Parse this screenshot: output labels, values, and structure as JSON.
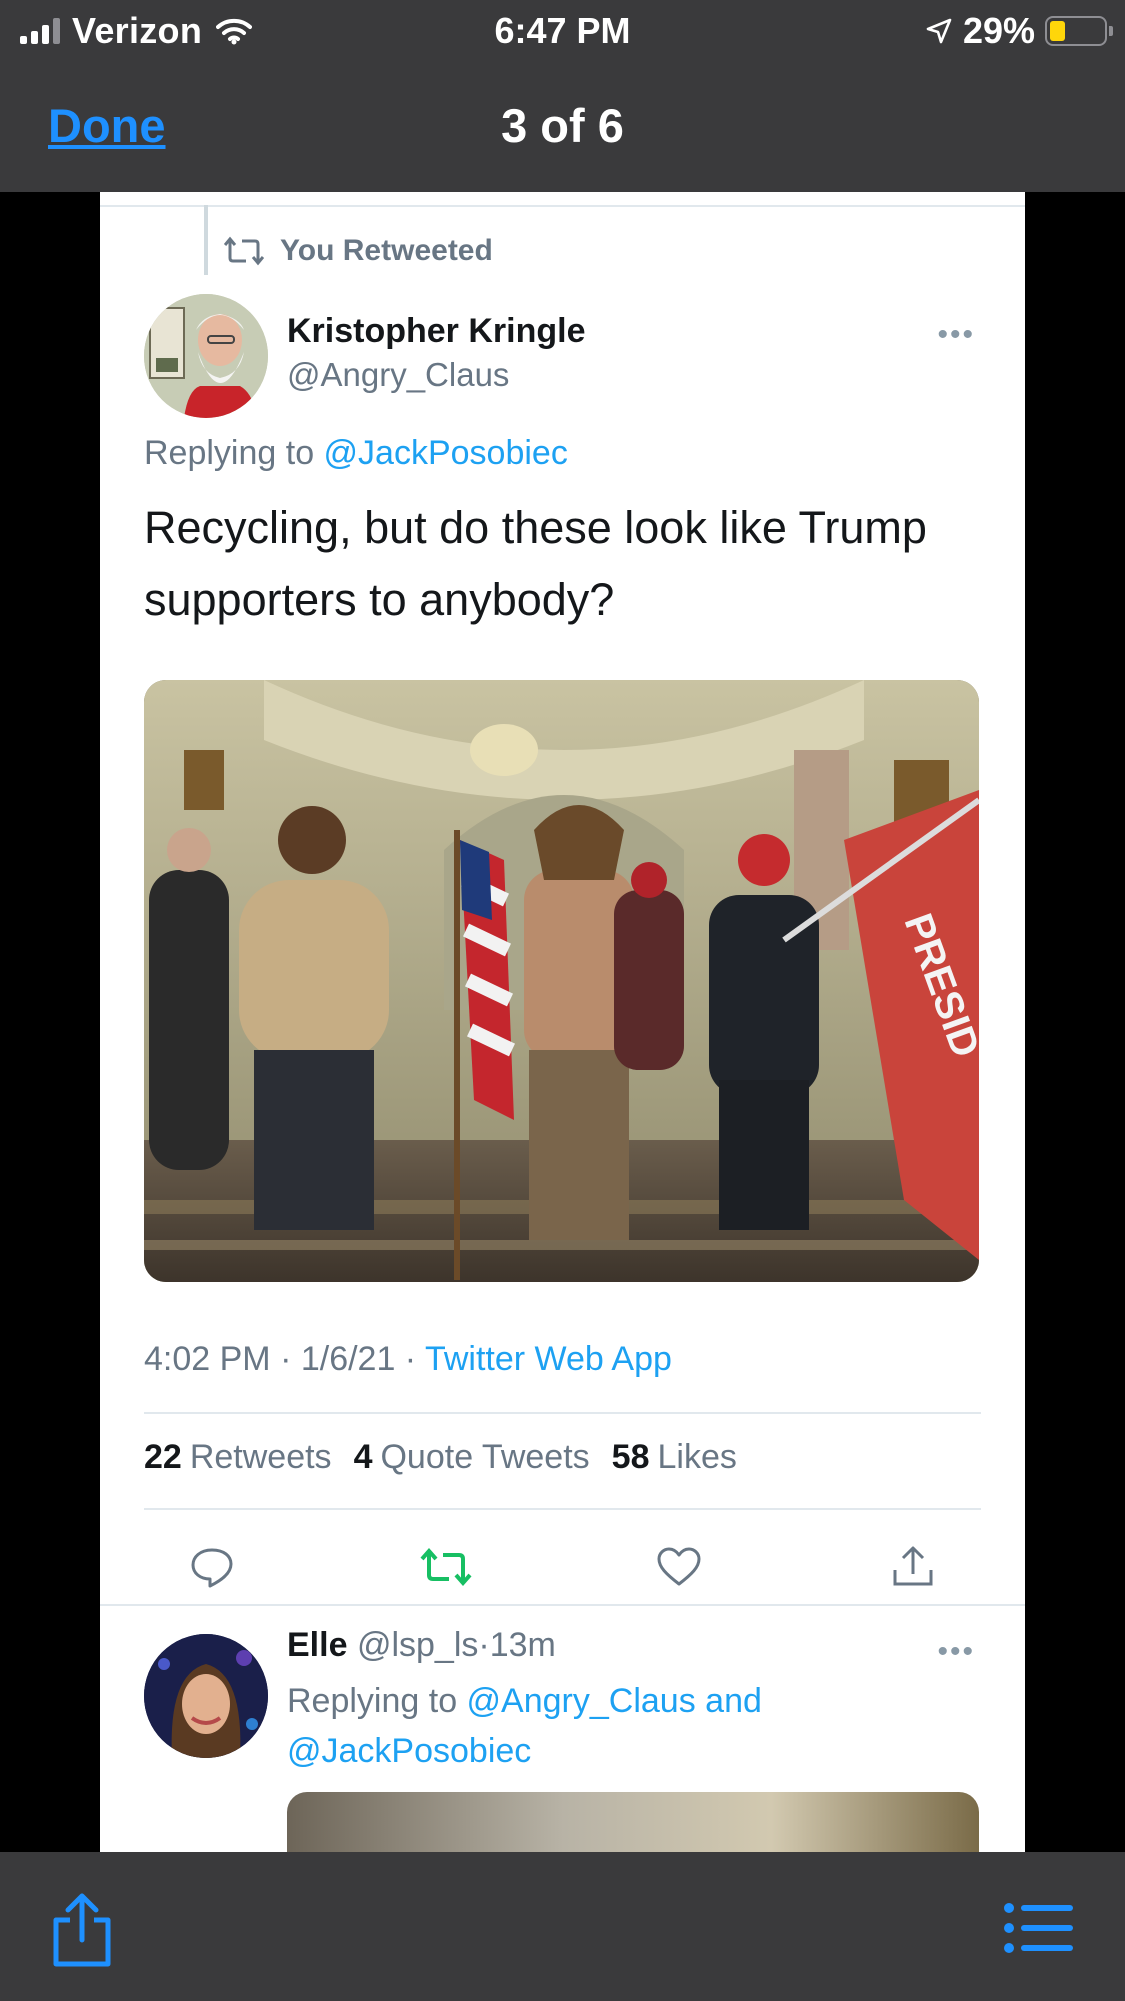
{
  "status_bar": {
    "carrier": "Verizon",
    "time": "6:47 PM",
    "battery_percent": "29%",
    "battery_level": 0.29,
    "icons": [
      "signal-icon",
      "wifi-icon",
      "location-arrow-icon",
      "battery-icon"
    ]
  },
  "nav": {
    "done_label": "Done",
    "title": "3 of 6"
  },
  "tweet": {
    "retweet_context": "You Retweeted",
    "author_name": "Kristopher Kringle",
    "author_handle": "@Angry_Claus",
    "reply_prefix": "Replying to ",
    "reply_mention": "@JackPosobiec",
    "text": "Recycling, but do these look like Trump supporters to anybody?",
    "timestamp": "4:02 PM · 1/6/21 · ",
    "source": "Twitter Web App",
    "stats": {
      "retweets_count": "22",
      "retweets_label": "Retweets",
      "quotes_count": "4",
      "quotes_label": "Quote Tweets",
      "likes_count": "58",
      "likes_label": "Likes"
    },
    "flag_text": "PRESID",
    "actions": [
      "reply-icon",
      "retweet-icon",
      "like-icon",
      "share-icon"
    ]
  },
  "reply": {
    "name": "Elle",
    "handle": "@lsp_ls",
    "separator": "·",
    "time": "13m",
    "reply_prefix": "Replying to ",
    "mention_1": "@Angry_Claus",
    "joiner": " and ",
    "mention_2": "@JackPosobiec"
  },
  "colors": {
    "link_blue": "#1da1f2",
    "retweet_green": "#17bf63",
    "done_blue": "#1e90ff",
    "toolbar_gray": "#3a3a3c"
  },
  "toolbar": {
    "icons": [
      "share-icon",
      "list-icon"
    ]
  }
}
